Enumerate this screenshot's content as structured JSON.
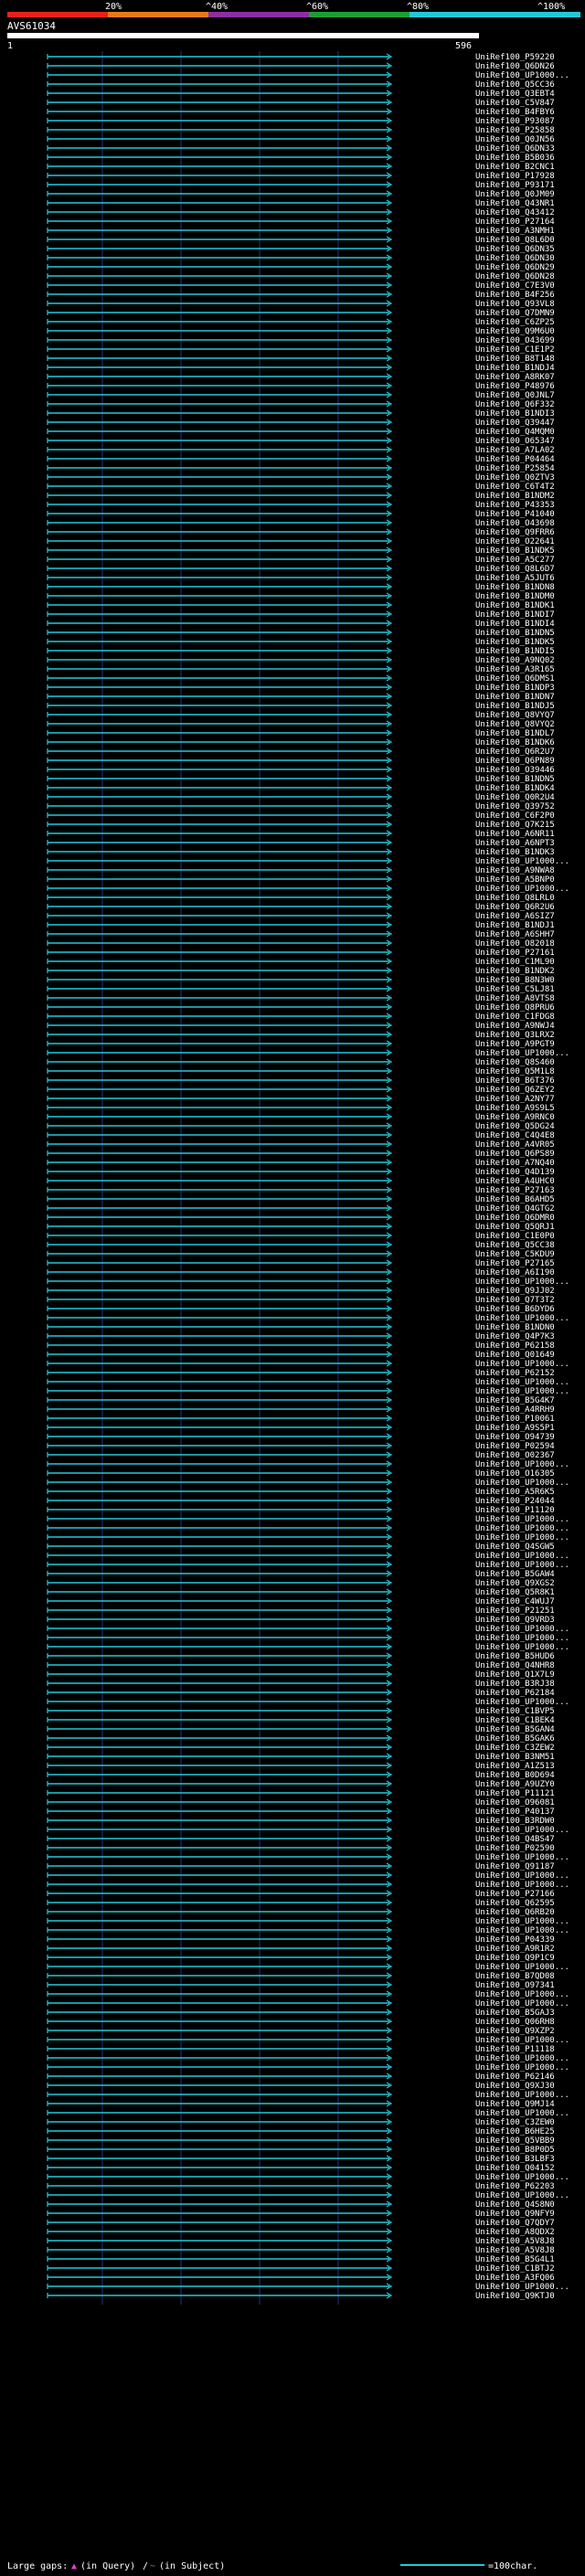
{
  "query_id": "AVS61034",
  "scale": {
    "start": "1",
    "end": "596"
  },
  "identity_scale": {
    "labels": [
      "20%",
      "^40%",
      "^60%",
      "^80%",
      "^100%"
    ],
    "colors": [
      "#e8211b",
      "#e87b18",
      "#8c2fa3",
      "#1aa032",
      "#22c8d8"
    ]
  },
  "colors": {
    "background": "#000000",
    "line": "#22c8d8",
    "grid": "#1a3a7a",
    "gap": "#e040c8",
    "insert": "#38b82a"
  },
  "footer": {
    "gaps_label": "Large gaps:",
    "in_query": "(in Query)",
    "slash": "/",
    "in_subject": "(in Subject)",
    "scale_label": "=100char."
  },
  "hits": [
    "UniRef100_P59220",
    "UniRef100_Q6DN26",
    "UniRef100_UP1000...",
    "UniRef100_Q5CC36",
    "UniRef100_Q3EBT4",
    "UniRef100_C5V847",
    "UniRef100_B4FBY6",
    "UniRef100_P93087",
    "UniRef100_P25858",
    "UniRef100_Q0JN56",
    "UniRef100_Q6DN33",
    "UniRef100_B5B036",
    "UniRef100_B2CNC1",
    "UniRef100_P17928",
    "UniRef100_P93171",
    "UniRef100_Q0JM09",
    "UniRef100_Q43NR1",
    "UniRef100_Q43412",
    "UniRef100_P27164",
    "UniRef100_A3NMH1",
    "UniRef100_Q8L6D0",
    "UniRef100_Q6DN35",
    "UniRef100_Q6DN30",
    "UniRef100_Q6DN29",
    "UniRef100_Q6DN28",
    "UniRef100_C7E3V0",
    "UniRef100_B4F256",
    "UniRef100_Q93VL8",
    "UniRef100_Q7DMN9",
    "UniRef100_C6ZP25",
    "UniRef100_Q9M6U0",
    "UniRef100_O43699",
    "UniRef100_C1E1P2",
    "UniRef100_B8T148",
    "UniRef100_B1NDJ4",
    "UniRef100_A8RK07",
    "UniRef100_P48976",
    "UniRef100_Q0JNL7",
    "UniRef100_Q6F332",
    "UniRef100_B1NDI3",
    "UniRef100_Q39447",
    "UniRef100_Q4MQM0",
    "UniRef100_O65347",
    "UniRef100_A7LA02",
    "UniRef100_P04464",
    "UniRef100_P25854",
    "UniRef100_Q0ZTV3",
    "UniRef100_C6T4T2",
    "UniRef100_B1NDM2",
    "UniRef100_P43353",
    "UniRef100_P41040",
    "UniRef100_O43698",
    "UniRef100_Q9FRR6",
    "UniRef100_O22641",
    "UniRef100_B1NDK5",
    "UniRef100_A5C277",
    "UniRef100_Q8L6D7",
    "UniRef100_A5JUT6",
    "UniRef100_B1NDN8",
    "UniRef100_B1NDM0",
    "UniRef100_B1NDK1",
    "UniRef100_B1NDI7",
    "UniRef100_B1NDI4",
    "UniRef100_B1NDN5",
    "UniRef100_B1NDK5",
    "UniRef100_B1NDI5",
    "UniRef100_A9NQ02",
    "UniRef100_A3R165",
    "UniRef100_Q6DMS1",
    "UniRef100_B1NDP3",
    "UniRef100_B1NDN7",
    "UniRef100_B1NDJ5",
    "UniRef100_Q8VYQ7",
    "UniRef100_Q8VYQ2",
    "UniRef100_B1NDL7",
    "UniRef100_B1NDK6",
    "UniRef100_Q6R2U7",
    "UniRef100_Q6PN89",
    "UniRef100_O39446",
    "UniRef100_B1NDN5",
    "UniRef100_B1NDK4",
    "UniRef100_Q0R2U4",
    "UniRef100_Q39752",
    "UniRef100_C6F2P0",
    "UniRef100_Q7K215",
    "UniRef100_A6NR11",
    "UniRef100_A6NPT3",
    "UniRef100_B1NDK3",
    "UniRef100_UP1000...",
    "UniRef100_A9NWA8",
    "UniRef100_A5BNP0",
    "UniRef100_UP1000...",
    "UniRef100_Q8LRL0",
    "UniRef100_Q6R2U6",
    "UniRef100_A6SIZ7",
    "UniRef100_B1NDJ1",
    "UniRef100_A6SHH7",
    "UniRef100_O82018",
    "UniRef100_P27161",
    "UniRef100_C1ML90",
    "UniRef100_B1NDK2",
    "UniRef100_B8N3W0",
    "UniRef100_C5LJ81",
    "UniRef100_A8VTS8",
    "UniRef100_Q8PRU6",
    "UniRef100_C1FDG8",
    "UniRef100_A9NWJ4",
    "UniRef100_Q3LRX2",
    "UniRef100_A9PGT9",
    "UniRef100_UP1000...",
    "UniRef100_Q8S460",
    "UniRef100_Q5M1L8",
    "UniRef100_B6T376",
    "UniRef100_Q6ZEY2",
    "UniRef100_A2NY77",
    "UniRef100_A9S9L5",
    "UniRef100_A9RNC0",
    "UniRef100_Q5DG24",
    "UniRef100_C4Q4E8",
    "UniRef100_A4VR05",
    "UniRef100_Q6PS89",
    "UniRef100_A7NQ40",
    "UniRef100_Q4D139",
    "UniRef100_A4UHC0",
    "UniRef100_P27163",
    "UniRef100_B6AHD5",
    "UniRef100_Q4GTG2",
    "UniRef100_Q6DMR0",
    "UniRef100_Q5QRJ1",
    "UniRef100_C1E0P0",
    "UniRef100_Q5CC38",
    "UniRef100_C5KDU9",
    "UniRef100_P27165",
    "UniRef100_A6I190",
    "UniRef100_UP1000...",
    "UniRef100_Q9JJ02",
    "UniRef100_Q7T3T2",
    "UniRef100_B6DYD6",
    "UniRef100_UP1000...",
    "UniRef100_B1NDN0",
    "UniRef100_Q4P7K3",
    "UniRef100_P62158",
    "UniRef100_Q01649",
    "UniRef100_UP1000...",
    "UniRef100_P62152",
    "UniRef100_UP1000...",
    "UniRef100_UP1000...",
    "UniRef100_B5G4K7",
    "UniRef100_A4RRH9",
    "UniRef100_P10061",
    "UniRef100_A9S5P1",
    "UniRef100_O94739",
    "UniRef100_P02594",
    "UniRef100_O02367",
    "UniRef100_UP1000...",
    "UniRef100_O16305",
    "UniRef100_UP1000...",
    "UniRef100_A5R6K5",
    "UniRef100_P24044",
    "UniRef100_P11120",
    "UniRef100_UP1000...",
    "UniRef100_UP1000...",
    "UniRef100_UP1000...",
    "UniRef100_Q4SGW5",
    "UniRef100_UP1000...",
    "UniRef100_UP1000...",
    "UniRef100_B5GAW4",
    "UniRef100_Q9XGS2",
    "UniRef100_Q5R8K1",
    "UniRef100_C4WUJ7",
    "UniRef100_P21251",
    "UniRef100_Q9VRD3",
    "UniRef100_UP1000...",
    "UniRef100_UP1000...",
    "UniRef100_UP1000...",
    "UniRef100_B5HUD6",
    "UniRef100_Q4NHR8",
    "UniRef100_Q1X7L9",
    "UniRef100_B3RJ38",
    "UniRef100_P62184",
    "UniRef100_UP1000...",
    "UniRef100_C1BVP5",
    "UniRef100_C1BEK4",
    "UniRef100_B5GAN4",
    "UniRef100_B5GAK6",
    "UniRef100_C3ZEW2",
    "UniRef100_B3NM51",
    "UniRef100_A1Z513",
    "UniRef100_B0D694",
    "UniRef100_A9UZY0",
    "UniRef100_P11121",
    "UniRef100_O96081",
    "UniRef100_P40137",
    "UniRef100_B3RDW0",
    "UniRef100_UP1000...",
    "UniRef100_Q4BS47",
    "UniRef100_P02590",
    "UniRef100_UP1000...",
    "UniRef100_Q91187",
    "UniRef100_UP1000...",
    "UniRef100_UP1000...",
    "UniRef100_P27166",
    "UniRef100_Q62595",
    "UniRef100_Q6RB20",
    "UniRef100_UP1000...",
    "UniRef100_UP1000...",
    "UniRef100_P04339",
    "UniRef100_A9R1R2",
    "UniRef100_Q9P1C9",
    "UniRef100_UP1000...",
    "UniRef100_B7QD08",
    "UniRef100_O97341",
    "UniRef100_UP1000...",
    "UniRef100_UP1000...",
    "UniRef100_B5GAJ3",
    "UniRef100_Q06RH8",
    "UniRef100_Q9XZP2",
    "UniRef100_UP1000...",
    "UniRef100_P11118",
    "UniRef100_UP1000...",
    "UniRef100_UP1000...",
    "UniRef100_P62146",
    "UniRef100_Q9XJ30",
    "UniRef100_UP1000...",
    "UniRef100_Q9MJ14",
    "UniRef100_UP1000...",
    "UniRef100_C3ZEW0",
    "UniRef100_B6HE25",
    "UniRef100_Q5VBB9",
    "UniRef100_B8P0D5",
    "UniRef100_B3LBF3",
    "UniRef100_Q04152",
    "UniRef100_UP1000...",
    "UniRef100_P62203",
    "UniRef100_UP1000...",
    "UniRef100_Q4S8N0",
    "UniRef100_Q9NFY9",
    "UniRef100_Q7QDY7",
    "UniRef100_A8QDX2",
    "UniRef100_A5V8J8",
    "UniRef100_A5V8J8",
    "UniRef100_B5G4L1",
    "UniRef100_C1BTJ2",
    "UniRef100_A3FQ06",
    "UniRef100_UP1000...",
    "UniRef100_Q9KTJ0"
  ]
}
